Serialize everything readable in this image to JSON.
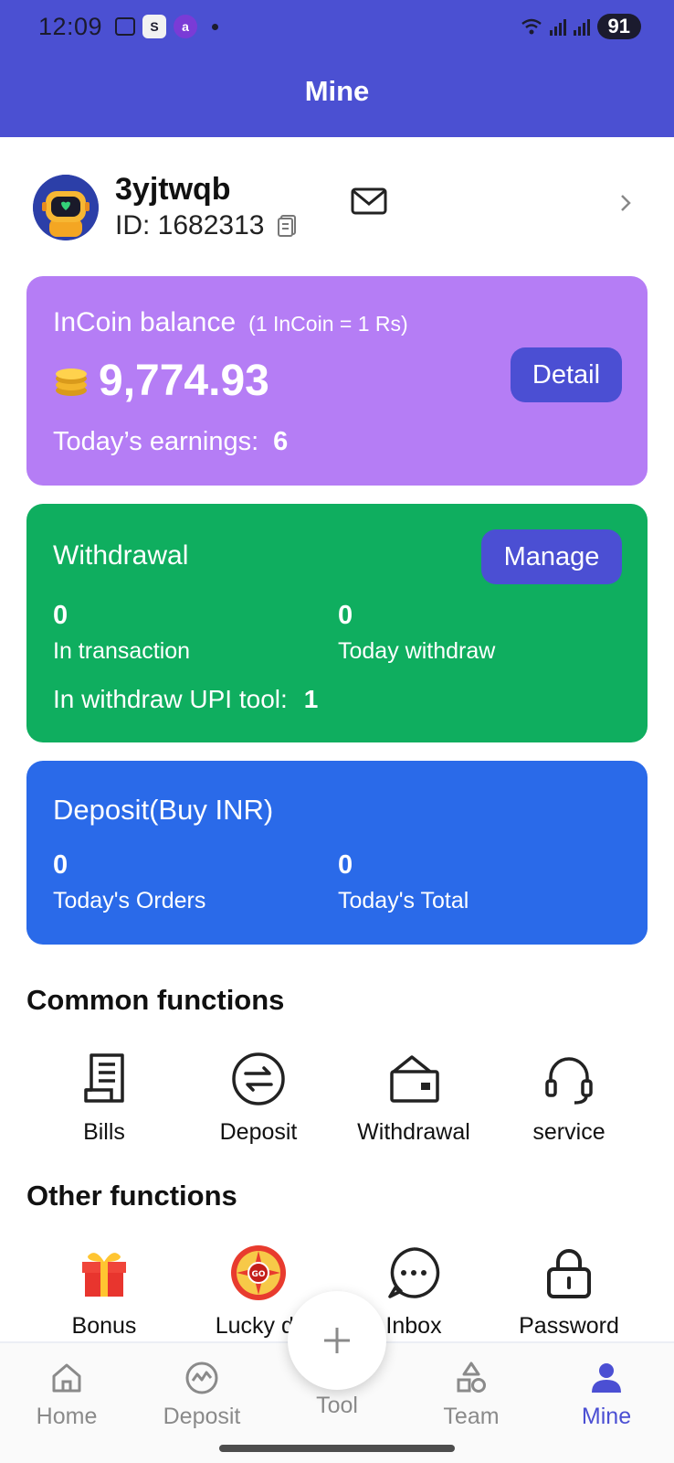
{
  "status_bar": {
    "time": "12:09",
    "battery": "91"
  },
  "header": {
    "title": "Mine"
  },
  "profile": {
    "username": "3yjtwqb",
    "id_text": "ID: 1682313"
  },
  "incoin": {
    "label": "InCoin balance",
    "rate": "(1 InCoin = 1 Rs)",
    "balance": "9,774.93",
    "earnings_label": "Today’s earnings:",
    "earnings_value": "6",
    "detail_button": "Detail"
  },
  "withdrawal": {
    "title": "Withdrawal",
    "manage_button": "Manage",
    "in_transaction_value": "0",
    "in_transaction_label": "In transaction",
    "today_withdraw_value": "0",
    "today_withdraw_label": "Today withdraw",
    "upi_label": "In withdraw UPI tool:",
    "upi_value": "1"
  },
  "deposit": {
    "title": "Deposit(Buy INR)",
    "orders_value": "0",
    "orders_label": "Today's Orders",
    "total_value": "0",
    "total_label": "Today's Total"
  },
  "common_functions": {
    "title": "Common functions",
    "items": [
      {
        "label": "Bills",
        "icon": "bill-icon"
      },
      {
        "label": "Deposit",
        "icon": "exchange-icon"
      },
      {
        "label": "Withdrawal",
        "icon": "wallet-icon"
      },
      {
        "label": "service",
        "icon": "headset-icon"
      }
    ]
  },
  "other_functions": {
    "title": "Other functions",
    "items": [
      {
        "label": "Bonus",
        "icon": "gift-icon"
      },
      {
        "label": "Lucky dr",
        "icon": "lucky-wheel-icon"
      },
      {
        "label": "Inbox",
        "icon": "chat-icon"
      },
      {
        "label": "Password",
        "icon": "lock-icon"
      }
    ]
  },
  "bottom_nav": {
    "items": [
      {
        "label": "Home",
        "icon": "home-icon",
        "active": false
      },
      {
        "label": "Deposit",
        "icon": "deposit-chart-icon",
        "active": false
      },
      {
        "label": "Tool",
        "icon": "plus-icon",
        "active": false
      },
      {
        "label": "Team",
        "icon": "shapes-icon",
        "active": false
      },
      {
        "label": "Mine",
        "icon": "person-icon",
        "active": true
      }
    ]
  },
  "colors": {
    "header": "#4B50D2",
    "incoin_card": "#B57DF5",
    "withdrawal_card": "#0FAE5F",
    "deposit_card": "#2A6AE9",
    "button": "#4B4FD3",
    "active_nav": "#4B4FD3"
  }
}
